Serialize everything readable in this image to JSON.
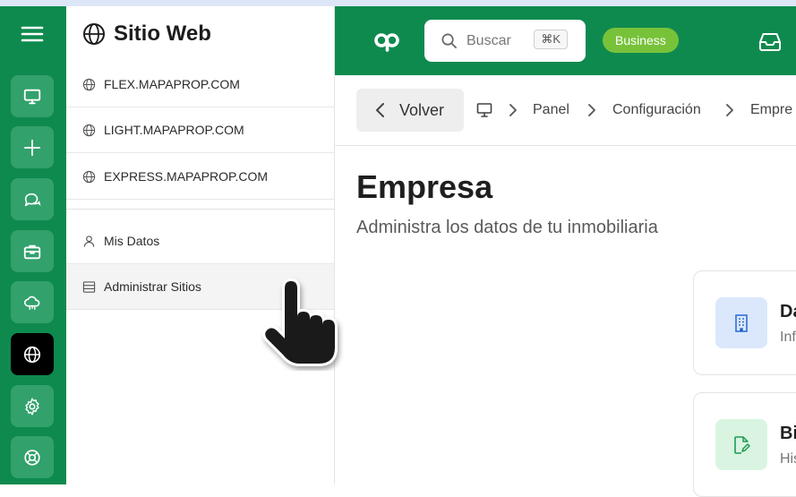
{
  "panel": {
    "title": "Sitio Web",
    "sites": [
      {
        "label": "FLEX.MAPAPROP.COM"
      },
      {
        "label": "LIGHT.MAPAPROP.COM"
      },
      {
        "label": "EXPRESS.MAPAPROP.COM"
      }
    ],
    "menu": [
      {
        "label": "Mis Datos",
        "icon": "user-icon"
      },
      {
        "label": "Administrar Sitios",
        "icon": "server-icon"
      }
    ]
  },
  "rail": {
    "items": [
      "monitor-icon",
      "plus-icon",
      "chat-icon",
      "briefcase-icon",
      "cloud-icon",
      "globe-icon",
      "gear-icon",
      "lifebuoy-icon"
    ],
    "active": "globe-icon"
  },
  "header": {
    "logo_text": "op",
    "search_placeholder": "Buscar",
    "search_shortcut": "⌘K",
    "plan_badge": "Business"
  },
  "breadcrumb": {
    "back_label": "Volver",
    "items": [
      "Panel",
      "Configuración",
      "Empre"
    ]
  },
  "page": {
    "title": "Empresa",
    "subtitle": "Administra los datos de tu inmobiliaria"
  },
  "cards": [
    {
      "title": "Da",
      "description": "Inf",
      "icon": "building-icon"
    },
    {
      "title": "Bi",
      "description": "His",
      "icon": "edit-document-icon"
    }
  ],
  "colors": {
    "brand_green": "#0f8a4f",
    "rail_button": "#32a16c",
    "badge_green": "#78c23a"
  }
}
